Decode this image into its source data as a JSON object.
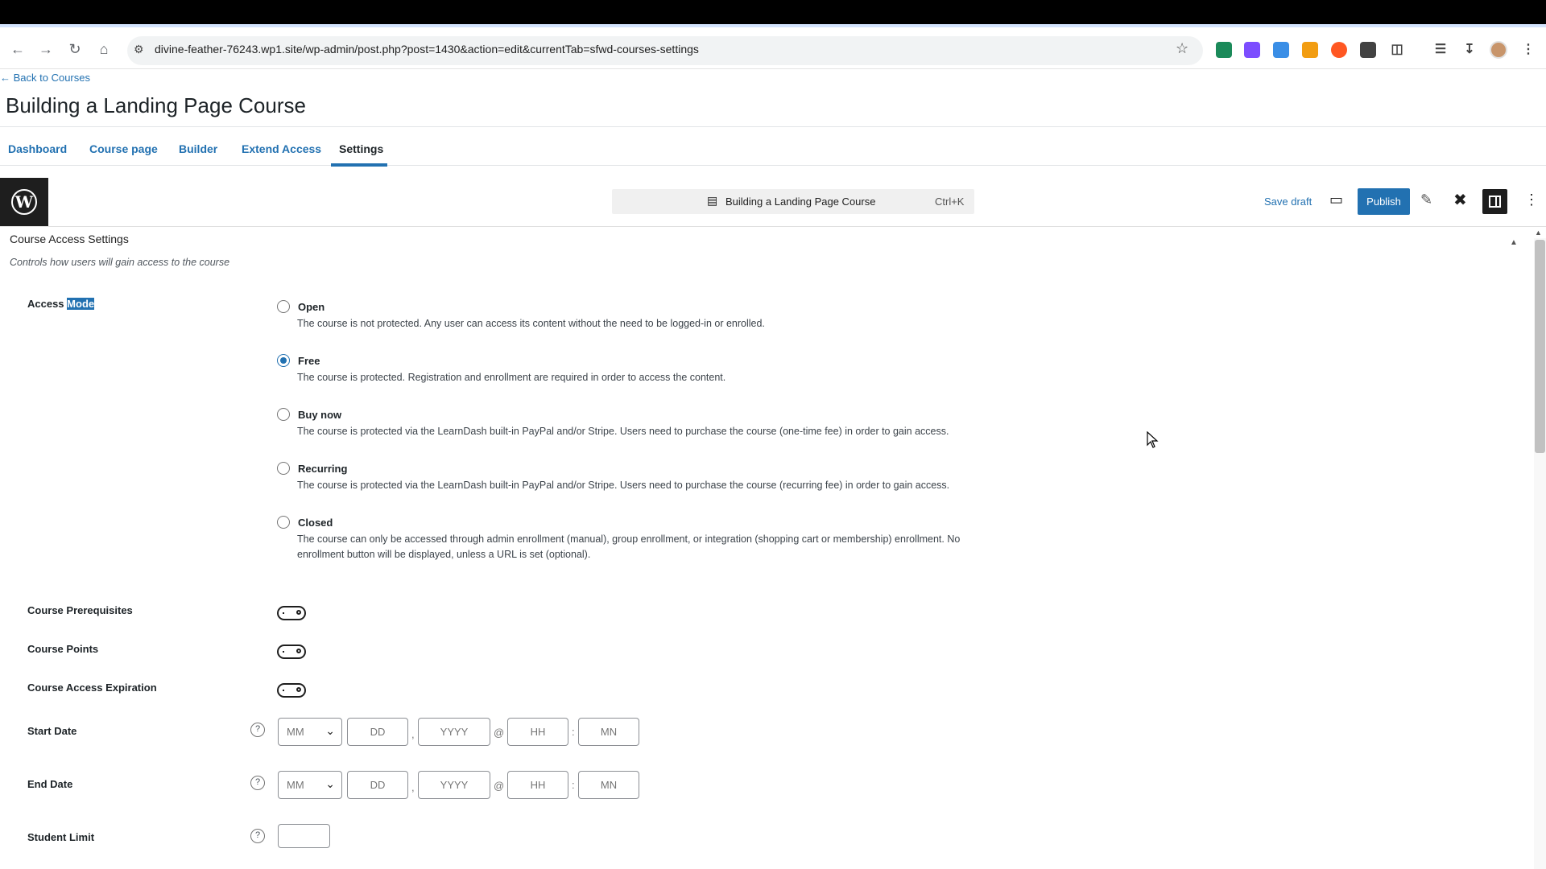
{
  "browser": {
    "url": "divine-feather-76243.wp1.site/wp-admin/post.php?post=1430&action=edit&currentTab=sfwd-courses-settings"
  },
  "header": {
    "back_link": "← Back to Courses",
    "title": "Building a Landing Page Course",
    "tabs": [
      "Dashboard",
      "Course page",
      "Builder",
      "Extend Access",
      "Settings"
    ],
    "active_tab": "Settings"
  },
  "editor": {
    "command_bar_title": "Building a Landing Page Course",
    "command_bar_shortcut": "Ctrl+K",
    "save_draft": "Save draft",
    "publish": "Publish"
  },
  "section": {
    "title": "Course Access Settings",
    "description": "Controls how users will gain access to the course"
  },
  "access_mode": {
    "label_prefix": "Access",
    "label_selected": "Mode",
    "selected": "Free",
    "options": [
      {
        "title": "Open",
        "desc": "The course is not protected. Any user can access its content without the need to be logged-in or enrolled."
      },
      {
        "title": "Free",
        "desc": "The course is protected. Registration and enrollment are required in order to access the content."
      },
      {
        "title": "Buy now",
        "desc": "The course is protected via the LearnDash built-in PayPal and/or Stripe. Users need to purchase the course (one-time fee) in order to gain access."
      },
      {
        "title": "Recurring",
        "desc": "The course is protected via the LearnDash built-in PayPal and/or Stripe. Users need to purchase the course (recurring fee) in order to gain access."
      },
      {
        "title": "Closed",
        "desc": "The course can only be accessed through admin enrollment (manual), group enrollment, or integration (shopping cart or membership) enrollment. No enrollment button will be displayed, unless a URL is set (optional)."
      }
    ]
  },
  "toggles": {
    "prerequisites": {
      "label": "Course Prerequisites",
      "on": false
    },
    "points": {
      "label": "Course Points",
      "on": false
    },
    "expiration": {
      "label": "Course Access Expiration",
      "on": false
    }
  },
  "dates": {
    "start_label": "Start Date",
    "end_label": "End Date",
    "placeholders": {
      "month": "MM",
      "day": "DD",
      "year": "YYYY",
      "hour": "HH",
      "minute": "MN"
    },
    "sep_comma": ",",
    "sep_at": "@",
    "sep_colon": ":"
  },
  "student_limit": {
    "label": "Student Limit",
    "value": ""
  },
  "help_glyph": "?",
  "colors": {
    "accent": "#2271b1",
    "dark": "#1e1e1e"
  }
}
